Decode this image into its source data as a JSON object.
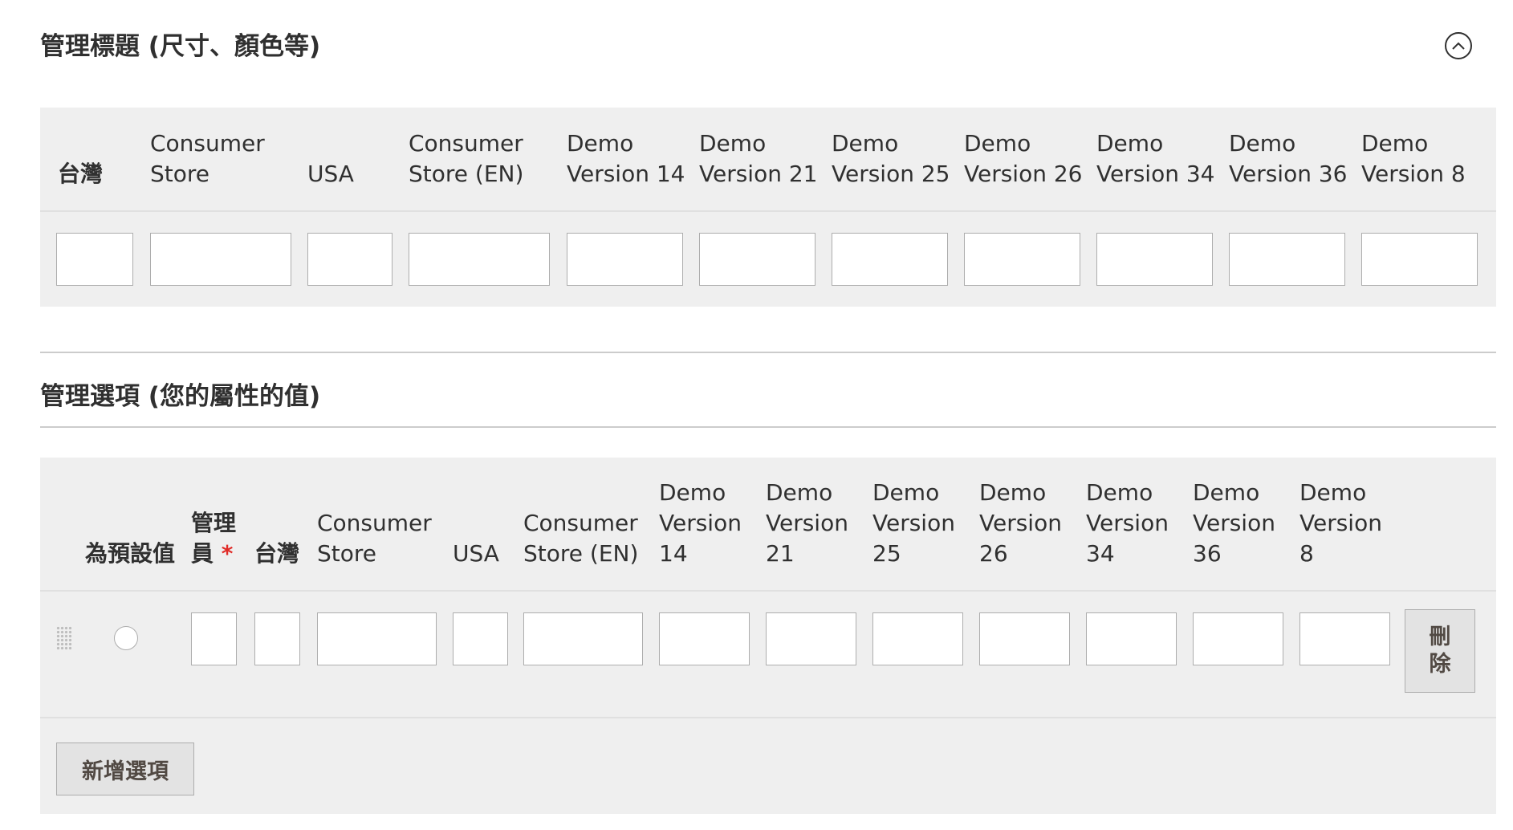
{
  "section1": {
    "title": "管理標題 (尺寸、顏色等)",
    "columns": [
      "台灣",
      "Consumer Store",
      "USA",
      "Consumer Store (EN)",
      "Demo Version 14",
      "Demo Version 21",
      "Demo Version 25",
      "Demo Version 26",
      "Demo Version 34",
      "Demo Version 36",
      "Demo Version 8"
    ],
    "values": [
      "",
      "",
      "",
      "",
      "",
      "",
      "",
      "",
      "",
      "",
      ""
    ]
  },
  "section2": {
    "title": "管理選項 (您的屬性的值)",
    "default_header": "為預設值",
    "admin_header": "管理員",
    "required_mark": "*",
    "columns": [
      "台灣",
      "Consumer Store",
      "USA",
      "Consumer Store (EN)",
      "Demo Version 14",
      "Demo Version 21",
      "Demo Version 25",
      "Demo Version 26",
      "Demo Version 34",
      "Demo Version 36",
      "Demo Version 8"
    ],
    "row_values": [
      "",
      "",
      "",
      "",
      "",
      "",
      "",
      "",
      "",
      "",
      "",
      ""
    ],
    "delete_label": "刪除",
    "add_option_label": "新增選項"
  },
  "icons": {
    "collapse": "chevron-up-circle-icon",
    "drag": "drag-handle-icon"
  }
}
